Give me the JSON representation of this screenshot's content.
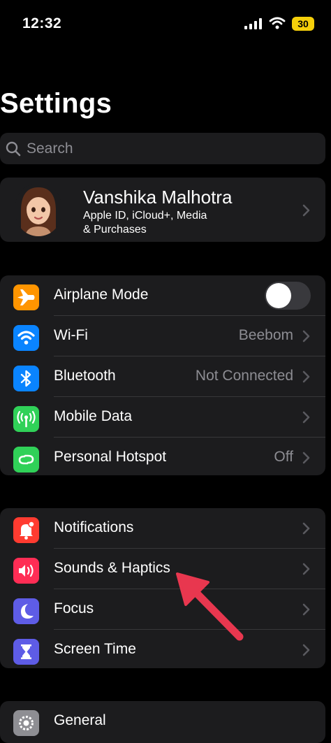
{
  "status_bar": {
    "time": "12:32",
    "battery": "30",
    "battery_color": "#f5cf0a"
  },
  "page_title": "Settings",
  "search": {
    "placeholder": "Search"
  },
  "profile": {
    "name": "Vanshika Malhotra",
    "subtitle_line1": "Apple ID, iCloud+, Media",
    "subtitle_line2": "& Purchases"
  },
  "connectivity": [
    {
      "label": "Airplane Mode",
      "icon": "airplane-icon",
      "color": "#ff9500",
      "toggle": "off"
    },
    {
      "label": "Wi-Fi",
      "value": "Beebom",
      "icon": "wifi-icon",
      "color": "#0a84ff"
    },
    {
      "label": "Bluetooth",
      "value": "Not Connected",
      "icon": "bluetooth-icon",
      "color": "#0a84ff"
    },
    {
      "label": "Mobile Data",
      "icon": "antenna-icon",
      "color": "#30d158"
    },
    {
      "label": "Personal Hotspot",
      "value": "Off",
      "icon": "hotspot-icon",
      "color": "#30d158"
    }
  ],
  "notifications_group": [
    {
      "label": "Notifications",
      "icon": "bell-icon",
      "color": "#ff3b30"
    },
    {
      "label": "Sounds & Haptics",
      "icon": "speaker-icon",
      "color": "#ff2d55"
    },
    {
      "label": "Focus",
      "icon": "moon-icon",
      "color": "#5e5ce6"
    },
    {
      "label": "Screen Time",
      "icon": "hourglass-icon",
      "color": "#5e5ce6"
    }
  ],
  "general": {
    "label": "General",
    "icon": "gear-icon",
    "color": "#8e8e93"
  },
  "annotation": {
    "color": "#e8374f"
  }
}
